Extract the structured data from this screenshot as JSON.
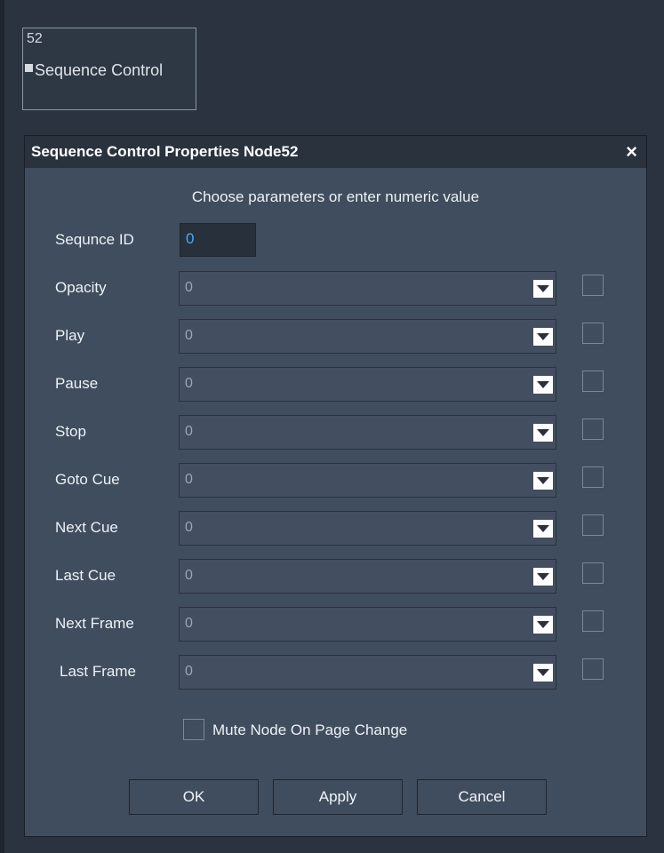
{
  "node": {
    "id": "52",
    "title": "Sequence Control"
  },
  "dialog": {
    "title": "Sequence Control Properties Node52",
    "close_symbol": "×",
    "instruction": "Choose parameters or enter numeric value",
    "sequence_id": {
      "label": "Sequnce ID",
      "value": "0"
    },
    "params": [
      {
        "label": "Opacity",
        "value": "0"
      },
      {
        "label": "Play",
        "value": "0"
      },
      {
        "label": "Pause",
        "value": "0"
      },
      {
        "label": "Stop",
        "value": "0"
      },
      {
        "label": "Goto Cue",
        "value": "0"
      },
      {
        "label": "Next Cue",
        "value": "0"
      },
      {
        "label": "Last Cue",
        "value": "0"
      },
      {
        "label": "Next Frame",
        "value": "0"
      },
      {
        "label": "Last Frame",
        "value": "0"
      }
    ],
    "mute_label": "Mute Node On Page Change",
    "buttons": {
      "ok": "OK",
      "apply": "Apply",
      "cancel": "Cancel"
    }
  }
}
